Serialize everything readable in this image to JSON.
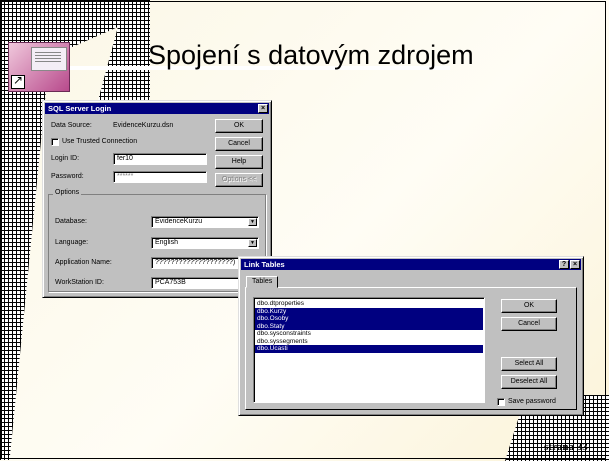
{
  "slide": {
    "title": "Spojení s datovým zdrojem",
    "page_number": "strana 33"
  },
  "sql_login": {
    "title": "SQL Server Login",
    "close_glyph": "×",
    "data_source_label": "Data Source:",
    "data_source_value": "EvidenceKurzu.dsn",
    "trusted_label": "Use Trusted Connection",
    "login_label": "Login ID:",
    "login_value": "fer10",
    "password_label": "Password:",
    "password_value": "******",
    "ok": "OK",
    "cancel": "Cancel",
    "help": "Help",
    "options": "Options <<",
    "options_group": "Options",
    "database_label": "Database:",
    "database_value": "EvidenceKurzu",
    "language_label": "Language:",
    "language_value": "English",
    "appname_label": "Application Name:",
    "appname_value": "????????????????????)",
    "workstation_label": "WorkStation ID:",
    "workstation_value": "PCA753B"
  },
  "link_tables": {
    "title": "Link Tables",
    "help_glyph": "?",
    "close_glyph": "×",
    "tab_label": "Tables",
    "items": [
      {
        "label": "dbo.dtproperties",
        "selected": false
      },
      {
        "label": "dbo.Kurzy",
        "selected": true
      },
      {
        "label": "dbo.Osoby",
        "selected": true
      },
      {
        "label": "dbo.Staty",
        "selected": true
      },
      {
        "label": "dbo.sysconstraints",
        "selected": false
      },
      {
        "label": "dbo.syssegments",
        "selected": false
      },
      {
        "label": "dbo.Ucasti",
        "selected": true
      }
    ],
    "ok": "OK",
    "cancel": "Cancel",
    "select_all": "Select All",
    "deselect_all": "Deselect All",
    "save_password": "Save password"
  }
}
